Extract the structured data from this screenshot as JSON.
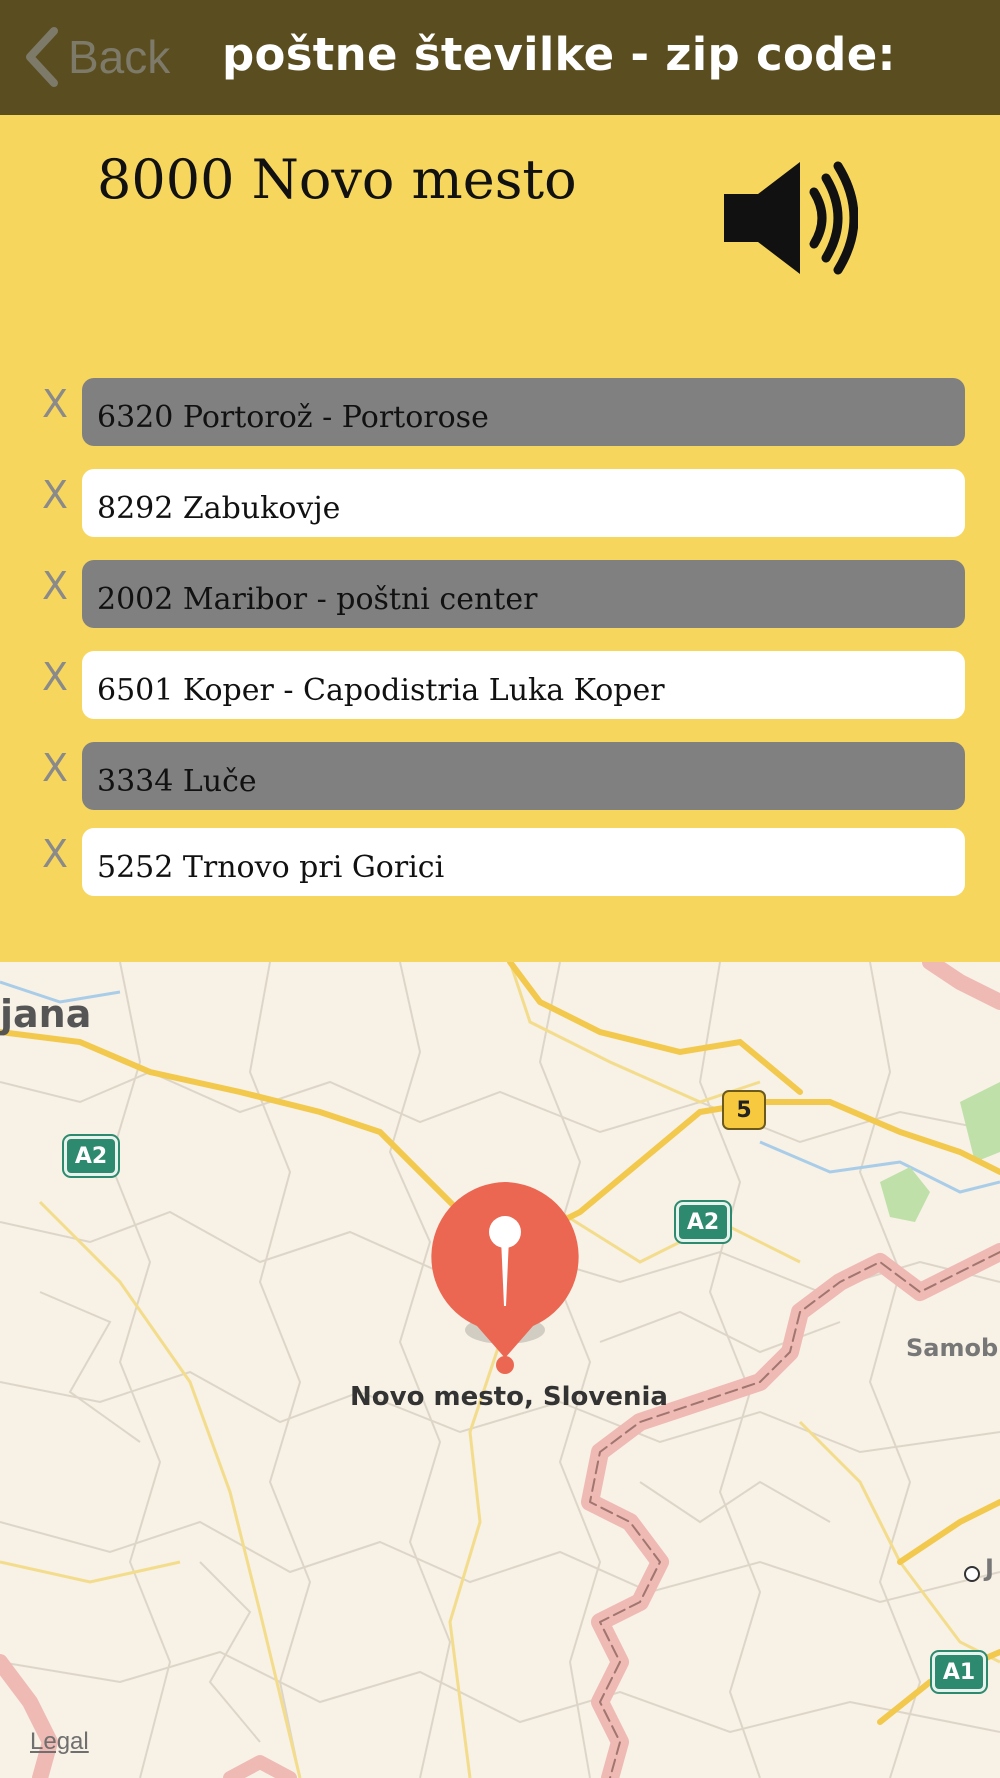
{
  "nav": {
    "back_label": "Back",
    "title": "poštne številke - zip code:"
  },
  "header": {
    "place": "8000 Novo mesto",
    "speaker_icon": "speaker-volume-icon"
  },
  "history": {
    "remove_label": "X",
    "items": [
      {
        "label": "6320 Portorož - Portorose",
        "style": "gray"
      },
      {
        "label": "8292 Zabukovje",
        "style": "white"
      },
      {
        "label": "2002 Maribor - poštni center",
        "style": "gray"
      },
      {
        "label": "6501 Koper - Capodistria Luka Koper",
        "style": "white"
      },
      {
        "label": "3334 Luče",
        "style": "gray"
      },
      {
        "label": "5252 Trnovo pri Gorici",
        "style": "white"
      }
    ]
  },
  "map": {
    "city_partial": "jana",
    "pin_label": "Novo mesto, Slovenia",
    "town_right": "Samob",
    "town_edge": "J",
    "shields": [
      "A2",
      "5",
      "A2",
      "A1"
    ],
    "legal": "Legal",
    "colors": {
      "land": "#f7f1e6",
      "highway": "#f2c94c",
      "border": "#e9a5a0",
      "pin": "#ec6752"
    }
  }
}
